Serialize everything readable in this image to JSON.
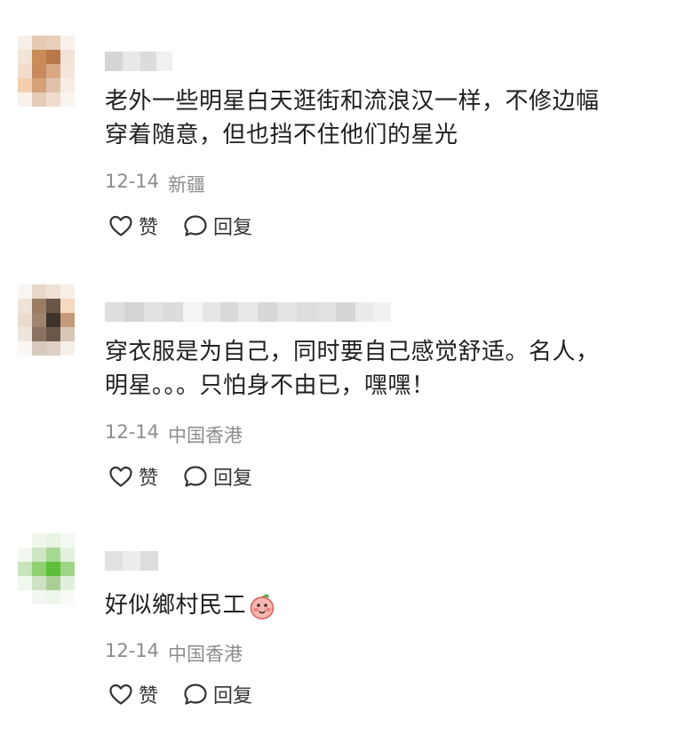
{
  "comments": [
    {
      "text_lines": [
        "老外一些明星白天逛街和流浪汉一样，不修边幅",
        "穿着随意，但也挡不住他们的星光"
      ],
      "date": "12-14",
      "location": "新疆",
      "like_label": "赞",
      "reply_label": "回复"
    },
    {
      "text_lines": [
        "穿衣服是为自己，同时要自己感觉舒适。名人，",
        "明星。。。只怕身不由已，嘿嘿！"
      ],
      "date": "12-14",
      "location": "中国香港",
      "like_label": "赞",
      "reply_label": "回复"
    },
    {
      "text_lines": [
        "好似鄉村民工"
      ],
      "date": "12-14",
      "location": "中国香港",
      "like_label": "赞",
      "reply_label": "回复",
      "emoji": "peach-face-emoji"
    }
  ],
  "icons": {
    "like": "heart-outline-icon",
    "reply": "speech-bubble-icon"
  },
  "colors": {
    "text": "#1f1f1f",
    "meta": "#8c8c8c",
    "action": "#333333"
  }
}
